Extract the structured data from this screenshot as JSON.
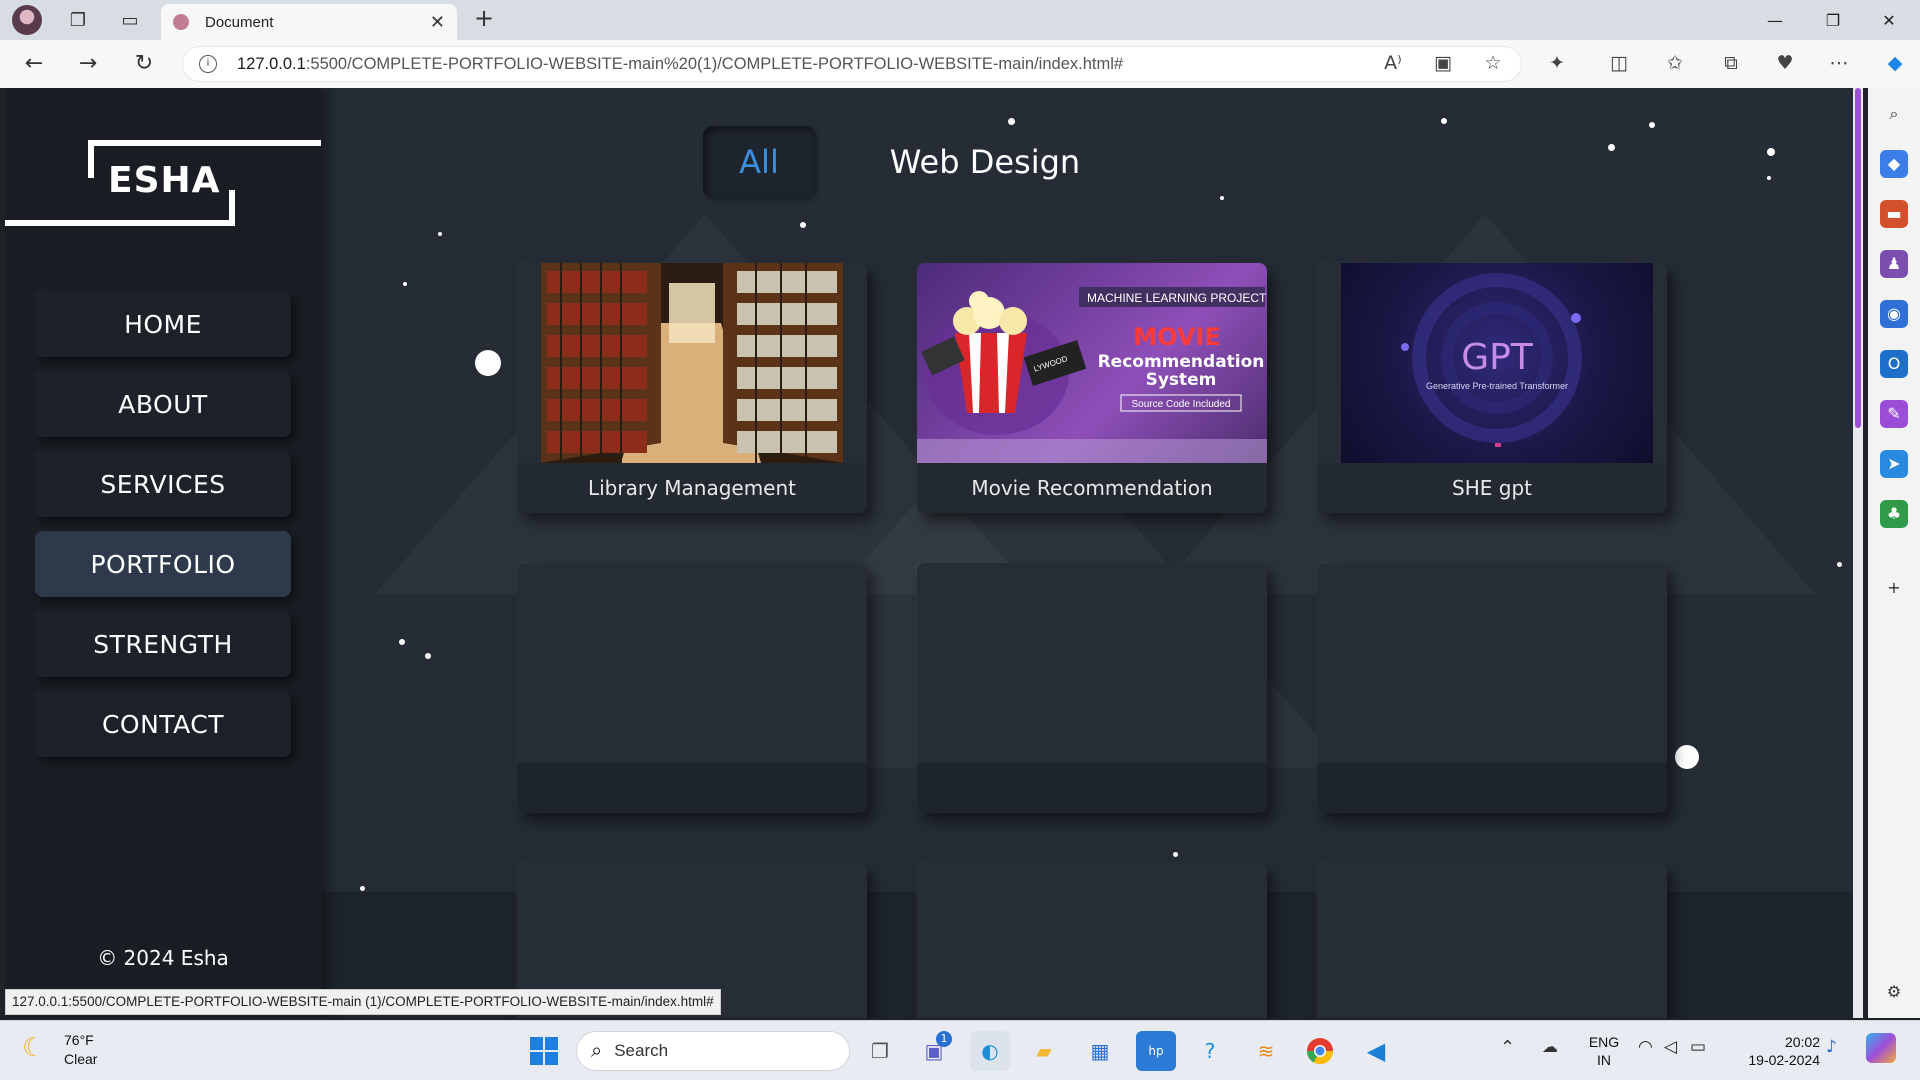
{
  "browser": {
    "tab_title": "Document",
    "url_host": "127.0.0.1",
    "url_rest": ":5500/COMPLETE-PORTFOLIO-WEBSITE-main%20(1)/COMPLETE-PORTFOLIO-WEBSITE-main/index.html#",
    "status_url": "127.0.0.1:5500/COMPLETE-PORTFOLIO-WEBSITE-main (1)/COMPLETE-PORTFOLIO-WEBSITE-main/index.html#"
  },
  "site": {
    "logo": "ESHA",
    "nav": [
      {
        "label": "HOME"
      },
      {
        "label": "ABOUT"
      },
      {
        "label": "SERVICES"
      },
      {
        "label": "PORTFOLIO"
      },
      {
        "label": "STRENGTH"
      },
      {
        "label": "CONTACT"
      }
    ],
    "active_nav": "PORTFOLIO",
    "copyright": "© 2024 Esha",
    "filters": {
      "all": "All",
      "web": "Web Design"
    },
    "projects": [
      {
        "title": "Library Management"
      },
      {
        "title": "Movie Recommendation",
        "image_text": {
          "tag": "MACHINE LEARNING PROJECT",
          "headline": "MOVIE",
          "sub1": "Recommendation",
          "sub2": "System",
          "badge": "Source Code Included",
          "clap": "LYWOOD"
        }
      },
      {
        "title": "SHE gpt",
        "image_text": {
          "headline": "GPT",
          "sub": "Generative Pre-trained Transformer"
        }
      }
    ]
  },
  "taskbar": {
    "weather_temp": "76°F",
    "weather_desc": "Clear",
    "search_placeholder": "Search",
    "lang1": "ENG",
    "lang2": "IN",
    "time": "20:02",
    "date": "19-02-2024",
    "chat_badge": "1"
  },
  "colors": {
    "accent_filter": "#3b8fe0",
    "scroll_thumb": "#9c4fd9",
    "page_bg": "#252c35"
  }
}
